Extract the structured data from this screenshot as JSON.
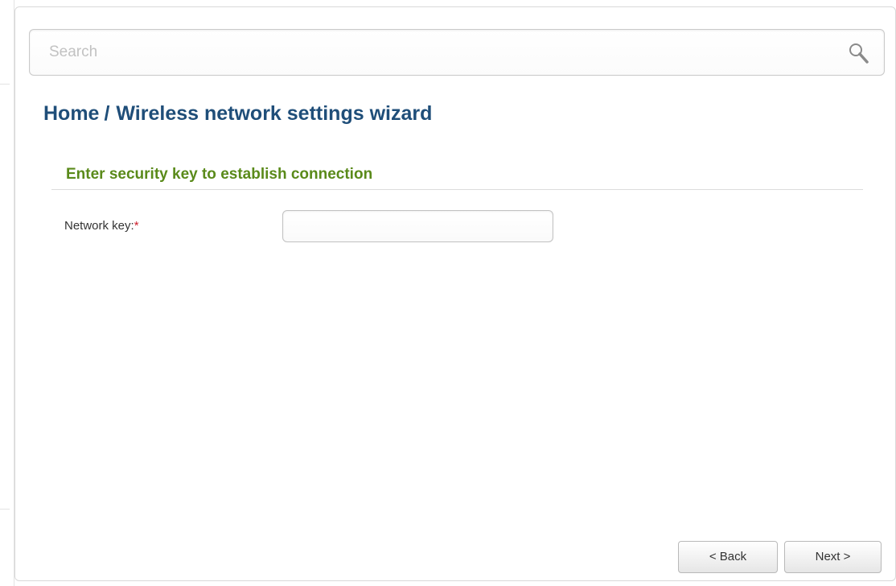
{
  "search": {
    "placeholder": "Search",
    "value": ""
  },
  "breadcrumb": {
    "home": "Home",
    "separator": "/",
    "current": "Wireless network settings wizard"
  },
  "section": {
    "title": "Enter security key to establish connection"
  },
  "form": {
    "network_key_label": "Network key:",
    "required_mark": "*",
    "network_key_value": ""
  },
  "buttons": {
    "back_label": "< Back",
    "next_label": "Next >"
  },
  "icons": {
    "search": "search-icon"
  },
  "colors": {
    "breadcrumb": "#1f4e79",
    "section_title": "#5a8a1a",
    "required": "#cc1e2c"
  }
}
